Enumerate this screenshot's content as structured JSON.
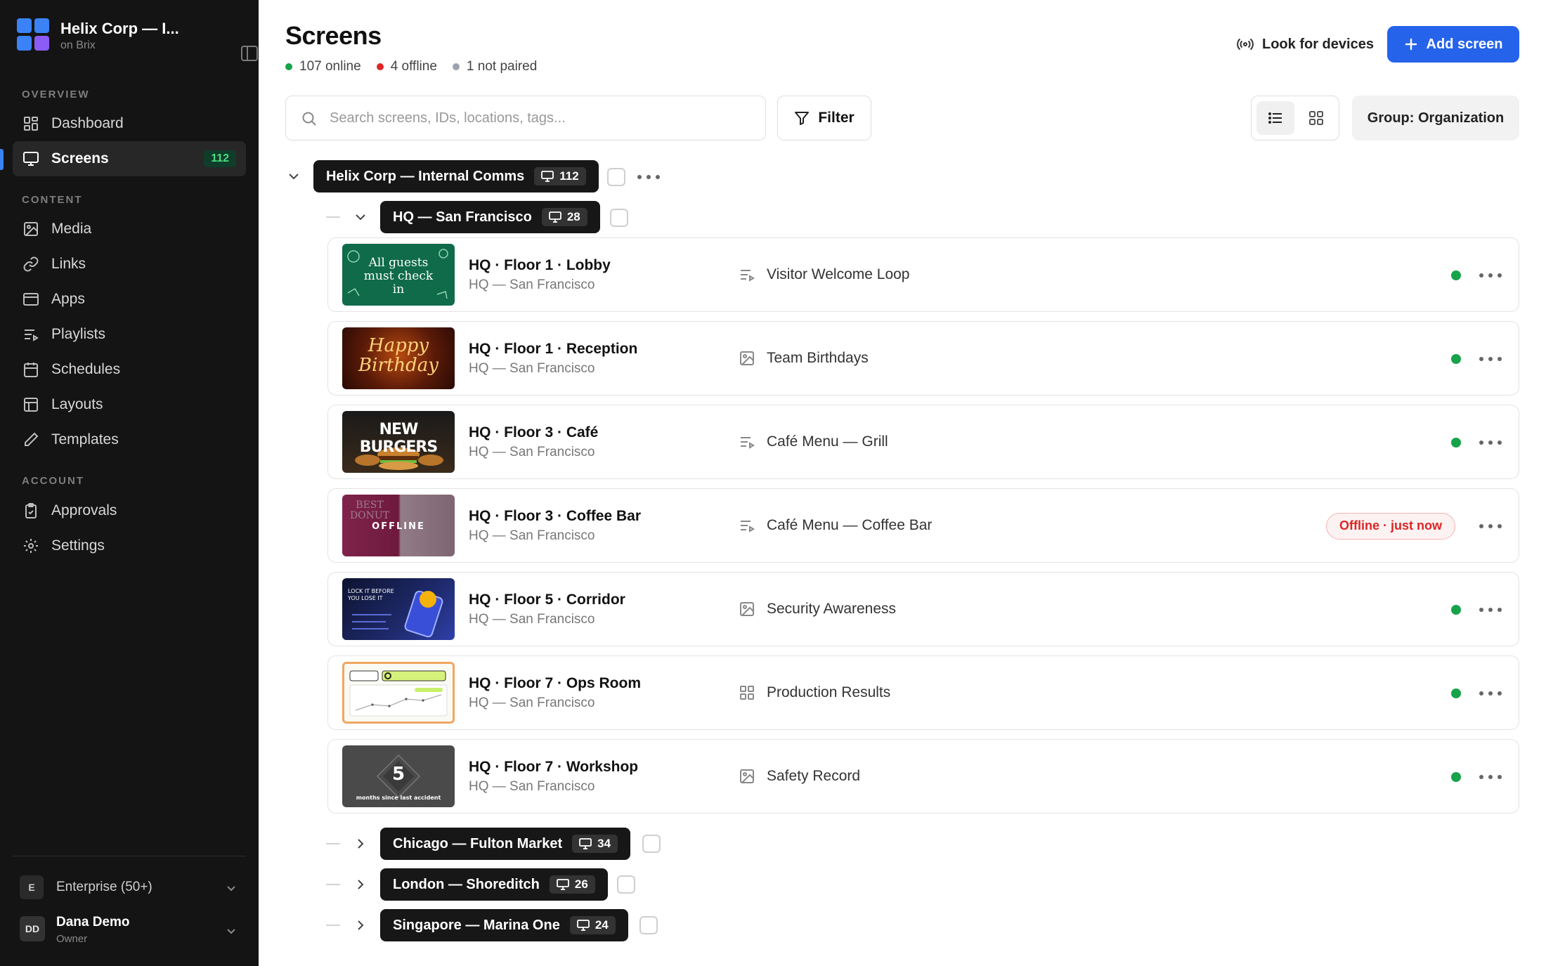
{
  "sidebar": {
    "org_name": "Helix Corp — I...",
    "org_sub": "on Brix",
    "sections": {
      "overview": "OVERVIEW",
      "content": "CONTENT",
      "account": "ACCOUNT"
    },
    "items": {
      "dashboard": "Dashboard",
      "screens": "Screens",
      "screens_count": "112",
      "media": "Media",
      "links": "Links",
      "apps": "Apps",
      "playlists": "Playlists",
      "schedules": "Schedules",
      "layouts": "Layouts",
      "templates": "Templates",
      "approvals": "Approvals",
      "settings": "Settings"
    },
    "plan": {
      "initial": "E",
      "label": "Enterprise (50+)"
    },
    "user": {
      "initials": "DD",
      "name": "Dana Demo",
      "role": "Owner"
    }
  },
  "header": {
    "title": "Screens",
    "status": {
      "online": "107 online",
      "offline": "4 offline",
      "not_paired": "1 not paired"
    },
    "look_label": "Look for devices",
    "add_label": "Add screen"
  },
  "toolbar": {
    "search_placeholder": "Search screens, IDs, locations, tags...",
    "filter_label": "Filter",
    "group_label": "Group: Organization"
  },
  "groups": {
    "org": {
      "name": "Helix Corp — Internal Comms",
      "count": "112"
    },
    "sf": {
      "name": "HQ — San Francisco",
      "count": "28"
    },
    "chicago": {
      "name": "Chicago — Fulton Market",
      "count": "34"
    },
    "london": {
      "name": "London — Shoreditch",
      "count": "26"
    },
    "singapore": {
      "name": "Singapore — Marina One",
      "count": "24"
    }
  },
  "screens": [
    {
      "name": "HQ · Floor 1 · Lobby",
      "location": "HQ — San Francisco",
      "content_type": "playlist",
      "content": "Visitor Welcome Loop",
      "status": "online",
      "thumb_text": "All guests must check in"
    },
    {
      "name": "HQ · Floor 1 · Reception",
      "location": "HQ — San Francisco",
      "content_type": "image",
      "content": "Team Birthdays",
      "status": "online",
      "thumb_text": "Happy Birthday"
    },
    {
      "name": "HQ · Floor 3 · Café",
      "location": "HQ — San Francisco",
      "content_type": "playlist",
      "content": "Café Menu — Grill",
      "status": "online",
      "thumb_text": "NEW BURGERS"
    },
    {
      "name": "HQ · Floor 3 · Coffee Bar",
      "location": "HQ — San Francisco",
      "content_type": "playlist",
      "content": "Café Menu — Coffee Bar",
      "status": "Offline · just now",
      "thumb_text": "BEST DONUT",
      "thumb_overlay": "OFFLINE"
    },
    {
      "name": "HQ · Floor 5 · Corridor",
      "location": "HQ — San Francisco",
      "content_type": "image",
      "content": "Security Awareness",
      "status": "online",
      "thumb_text": "LOCK IT BEFORE YOU LOSE IT"
    },
    {
      "name": "HQ · Floor 7 · Ops Room",
      "location": "HQ — San Francisco",
      "content_type": "layout",
      "content": "Production Results",
      "status": "online",
      "thumb_text": ""
    },
    {
      "name": "HQ · Floor 7 · Workshop",
      "location": "HQ — San Francisco",
      "content_type": "image",
      "content": "Safety Record",
      "status": "online",
      "thumb_text": "5",
      "thumb_sub": "months since last accident"
    }
  ],
  "colors": {
    "accent": "#2563eb",
    "online": "#16a34a",
    "offline": "#dc2626",
    "not_paired": "#9ca3af",
    "sidebar_bg": "#141414"
  }
}
